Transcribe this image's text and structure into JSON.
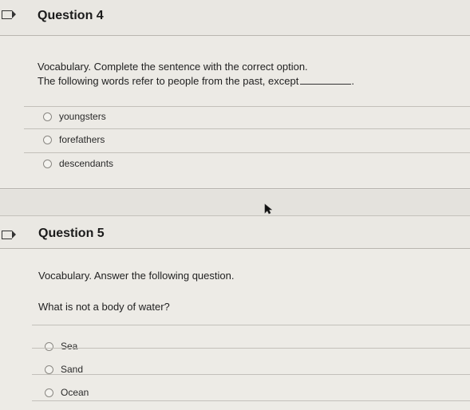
{
  "questions": [
    {
      "title": "Question 4",
      "instruction": "Vocabulary. Complete the sentence with the correct option.",
      "prompt": "The following words refer to people from the past, except",
      "prompt_end": ".",
      "options": [
        "youngsters",
        "forefathers",
        "descendants"
      ]
    },
    {
      "title": "Question 5",
      "instruction": "Vocabulary. Answer the following question.",
      "prompt": "What is not a body of water?",
      "options": [
        "Sea",
        "Sand",
        "Ocean"
      ]
    }
  ],
  "icons": {
    "flag": "flag-icon",
    "radio": "radio-circle-icon",
    "cursor": "mouse-pointer-icon"
  }
}
